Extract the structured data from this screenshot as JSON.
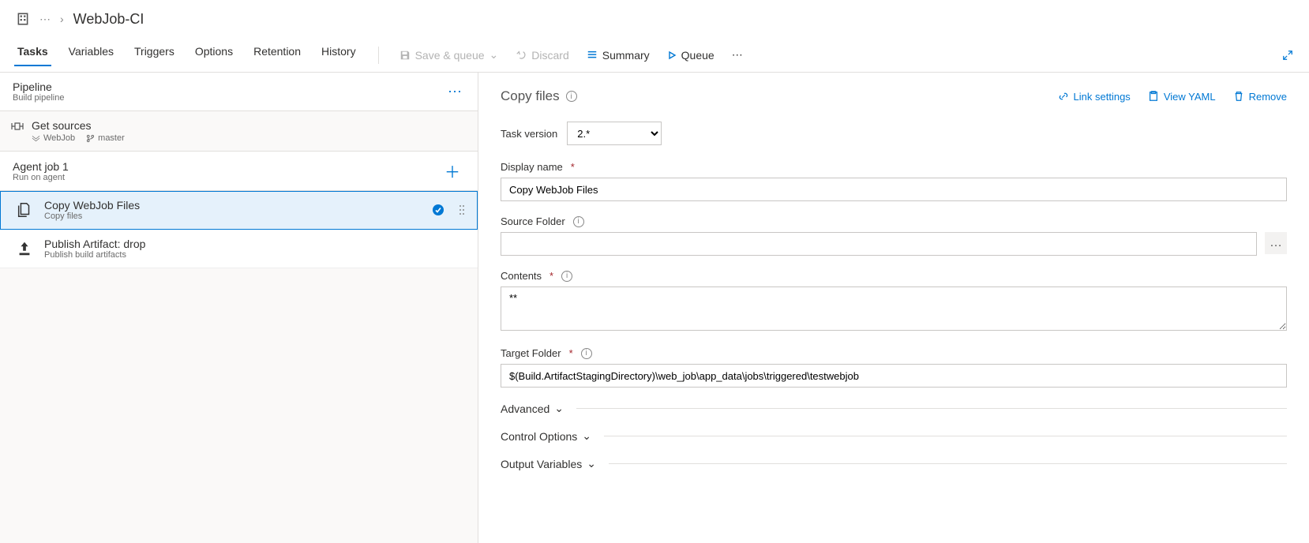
{
  "breadcrumb": {
    "title": "WebJob-CI"
  },
  "tabs": {
    "tasks": "Tasks",
    "variables": "Variables",
    "triggers": "Triggers",
    "options": "Options",
    "retention": "Retention",
    "history": "History"
  },
  "toolbar": {
    "save_queue": "Save & queue",
    "discard": "Discard",
    "summary": "Summary",
    "queue": "Queue"
  },
  "left": {
    "pipeline": {
      "title": "Pipeline",
      "sub": "Build pipeline"
    },
    "get_sources": {
      "title": "Get sources",
      "repo": "WebJob",
      "branch": "master"
    },
    "agent": {
      "title": "Agent job 1",
      "sub": "Run on agent"
    },
    "tasks": [
      {
        "title": "Copy WebJob Files",
        "sub": "Copy files",
        "selected": true
      },
      {
        "title": "Publish Artifact: drop",
        "sub": "Publish build artifacts",
        "selected": false
      }
    ]
  },
  "right": {
    "heading": "Copy files",
    "links": {
      "link_settings": "Link settings",
      "view_yaml": "View YAML",
      "remove": "Remove"
    },
    "task_version_label": "Task version",
    "task_version_value": "2.*",
    "display_name": {
      "label": "Display name",
      "value": "Copy WebJob Files"
    },
    "source_folder": {
      "label": "Source Folder",
      "value": ""
    },
    "contents": {
      "label": "Contents",
      "value": "**"
    },
    "target_folder": {
      "label": "Target Folder",
      "value": "$(Build.ArtifactStagingDirectory)\\web_job\\app_data\\jobs\\triggered\\testwebjob"
    },
    "sections": {
      "advanced": "Advanced",
      "control": "Control Options",
      "output": "Output Variables"
    }
  }
}
